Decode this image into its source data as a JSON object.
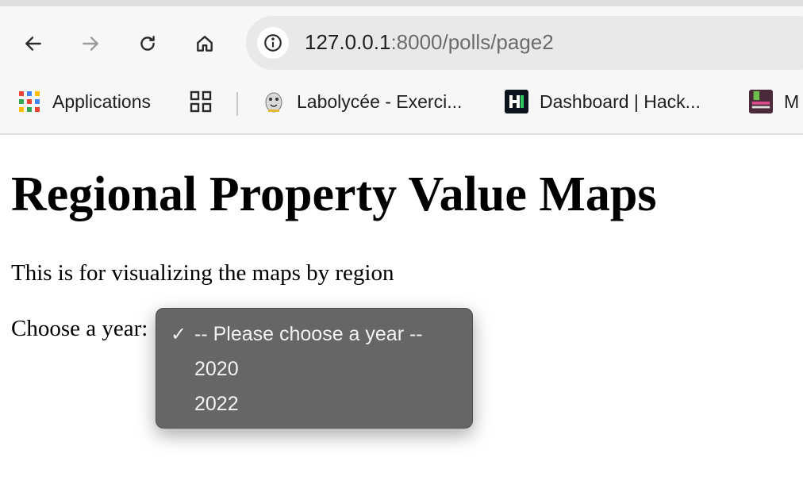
{
  "browser": {
    "url_host": "127.0.0.1",
    "url_rest": ":8000/polls/page2",
    "icons": {
      "back": "arrow-left-icon",
      "forward": "arrow-right-icon",
      "reload": "reload-icon",
      "home": "home-icon",
      "site_info": "info-icon"
    }
  },
  "bookmarks": [
    {
      "label": "Applications",
      "icon": "apps-grid-icon"
    },
    {
      "label": "",
      "icon": "tab-groups-icon"
    },
    {
      "label": "Labolycée - Exerci...",
      "icon": "labolycee-favicon"
    },
    {
      "label": "Dashboard | Hack...",
      "icon": "hackerrank-favicon"
    },
    {
      "label": "M",
      "icon": "lycee-favicon"
    }
  ],
  "page": {
    "title": "Regional Property Value Maps",
    "description": "This is for visualizing the maps by region",
    "year_label": "Choose a year:"
  },
  "year_select": {
    "checkmark": "✓",
    "options": [
      "-- Please choose a year --",
      "2020",
      "2022"
    ],
    "selected": "-- Please choose a year --"
  },
  "colors": {
    "dropdown_bg": "#666666",
    "chrome_bg": "#f7f7f7",
    "omnibox_bg": "#e9e9e9"
  }
}
